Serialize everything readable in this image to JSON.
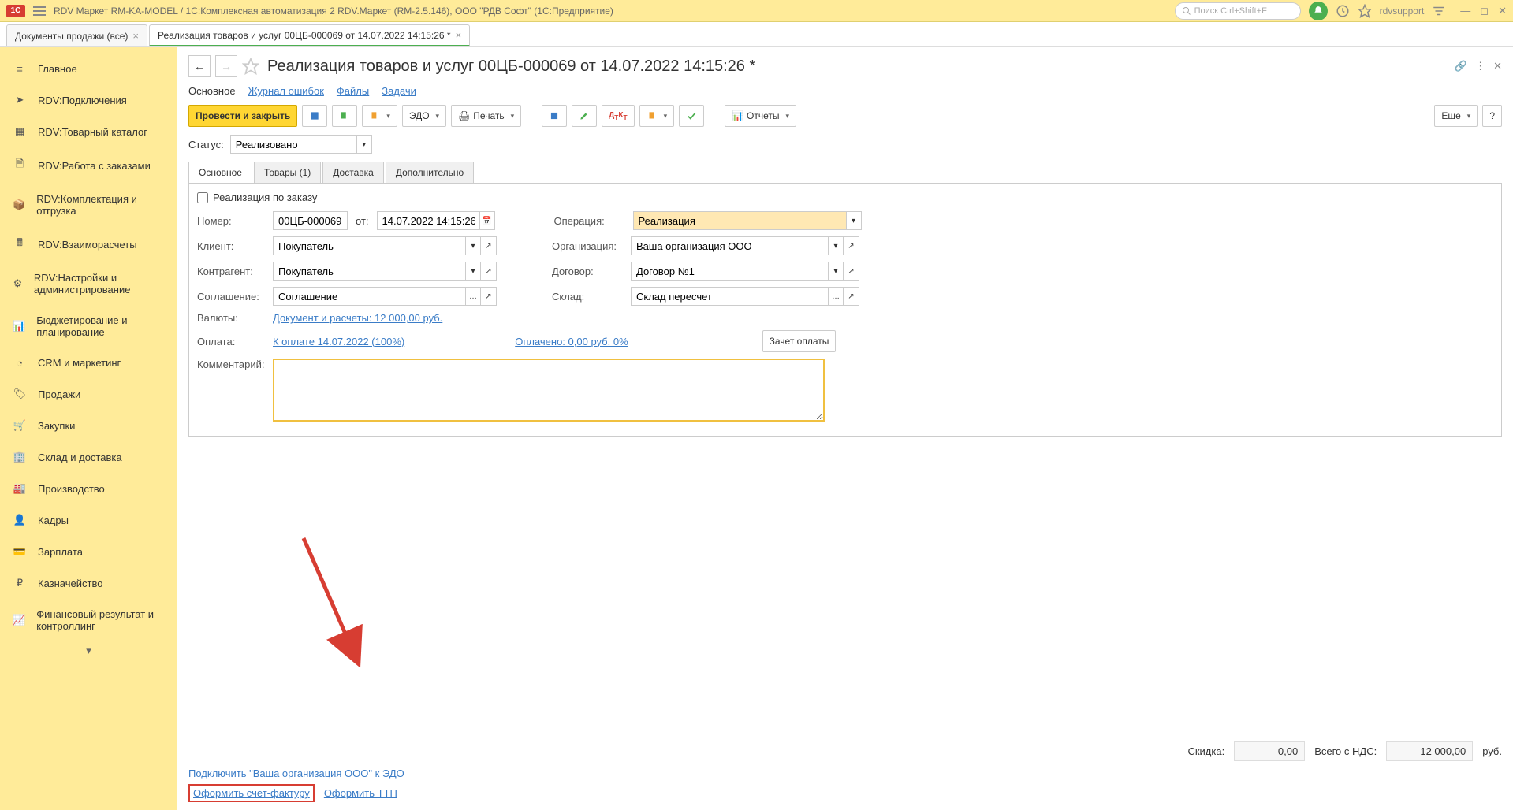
{
  "titlebar": {
    "title": "RDV Маркет RM-KA-MODEL / 1С:Комплексная автоматизация 2 RDV.Маркет (RM-2.5.146), ООО \"РДВ Софт\"  (1С:Предприятие)",
    "search_placeholder": "Поиск Ctrl+Shift+F",
    "user": "rdvsupport"
  },
  "tabs": [
    {
      "label": "Документы продажи (все)"
    },
    {
      "label": "Реализация товаров и услуг 00ЦБ-000069 от 14.07.2022 14:15:26 *",
      "active": true
    }
  ],
  "sidebar": [
    "Главное",
    "RDV:Подключения",
    "RDV:Товарный каталог",
    "RDV:Работа с заказами",
    "RDV:Комплектация и отгрузка",
    "RDV:Взаиморасчеты",
    "RDV:Настройки и администрирование",
    "Бюджетирование и планирование",
    "CRM и маркетинг",
    "Продажи",
    "Закупки",
    "Склад и доставка",
    "Производство",
    "Кадры",
    "Зарплата",
    "Казначейство",
    "Финансовый результат и контроллинг"
  ],
  "page": {
    "title": "Реализация товаров и услуг 00ЦБ-000069 от 14.07.2022 14:15:26 *",
    "navlinks": [
      "Основное",
      "Журнал ошибок",
      "Файлы",
      "Задачи"
    ],
    "toolbar": {
      "post_close": "Провести и закрыть",
      "edo": "ЭДО",
      "print": "Печать",
      "reports": "Отчеты",
      "more": "Еще",
      "help": "?"
    },
    "status_label": "Статус:",
    "status_value": "Реализовано",
    "inner_tabs": [
      "Основное",
      "Товары (1)",
      "Доставка",
      "Дополнительно"
    ],
    "form": {
      "by_order": "Реализация по заказу",
      "number_label": "Номер:",
      "number": "00ЦБ-000069",
      "from_label": "от:",
      "date": "14.07.2022 14:15:26",
      "operation_label": "Операция:",
      "operation": "Реализация",
      "client_label": "Клиент:",
      "client": "Покупатель",
      "org_label": "Организация:",
      "org": "Ваша организация ООО",
      "counterparty_label": "Контрагент:",
      "counterparty": "Покупатель",
      "contract_label": "Договор:",
      "contract": "Договор №1",
      "agreement_label": "Соглашение:",
      "agreement": "Соглашение",
      "warehouse_label": "Склад:",
      "warehouse": "Склад пересчет",
      "currency_label": "Валюты:",
      "currency_link": "Документ и расчеты: 12 000,00 руб.",
      "payment_label": "Оплата:",
      "payment_link": "К оплате 14.07.2022 (100%)",
      "paid_link": "Оплачено: 0,00 руб.   0%",
      "offset_btn": "Зачет оплаты",
      "comment_label": "Комментарий:"
    },
    "bottom": {
      "edo_connect": "Подключить \"Ваша организация ООО\" к ЭДО",
      "invoice": "Оформить счет-фактуру",
      "ttn": "Оформить ТТН"
    },
    "totals": {
      "discount_label": "Скидка:",
      "discount": "0,00",
      "vat_label": "Всего с НДС:",
      "vat": "12 000,00",
      "cur": "руб."
    }
  }
}
